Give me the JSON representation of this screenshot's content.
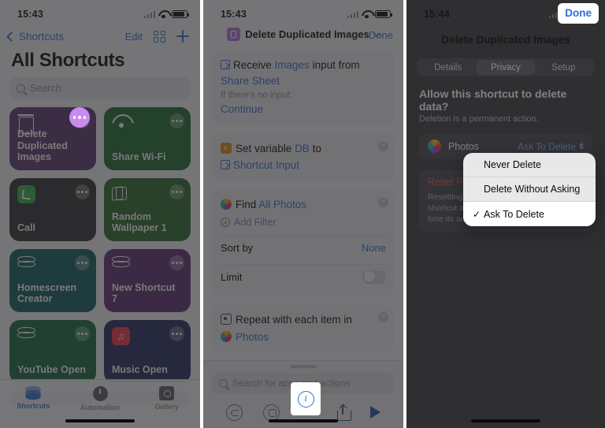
{
  "panel1": {
    "status": {
      "time": "15:43"
    },
    "nav": {
      "back_label": "Shortcuts",
      "edit_label": "Edit"
    },
    "title": "All Shortcuts",
    "search_placeholder": "Search",
    "tiles": [
      {
        "name": "Delete Duplicated Images",
        "icon": "trash-icon",
        "color": "#5a3770",
        "highlighted": true
      },
      {
        "name": "Share Wi-Fi",
        "icon": "wifi-icon",
        "color": "#1e6b2e"
      },
      {
        "name": "Call",
        "icon": "phone-icon",
        "color": "#303034"
      },
      {
        "name": "Random Wallpaper 1",
        "icon": "layers-icon",
        "color": "#2b6b2c"
      },
      {
        "name": "Homescreen Creator",
        "icon": "stack-icon",
        "color": "#0f5c5c"
      },
      {
        "name": "New Shortcut 7",
        "icon": "stack-icon",
        "color": "#5d2e72"
      },
      {
        "name": "YouTube Open",
        "icon": "stack-icon",
        "color": "#16663f"
      },
      {
        "name": "Music Open",
        "icon": "music-icon",
        "color": "#23295c"
      }
    ],
    "tabs": [
      {
        "label": "Shortcuts",
        "icon": "stack-icon",
        "active": true
      },
      {
        "label": "Automation",
        "icon": "clock-icon",
        "active": false
      },
      {
        "label": "Gallery",
        "icon": "gallery-icon",
        "active": false
      }
    ]
  },
  "panel2": {
    "status": {
      "time": "15:43"
    },
    "header": {
      "title": "Delete Duplicated Images",
      "done_label": "Done"
    },
    "cards": {
      "receive": {
        "word_receive": "Receive",
        "token_images": "Images",
        "word_input": "input",
        "word_from": "from",
        "token_sharesheet": "Share Sheet",
        "no_input_label": "If there's no input:",
        "no_input_value": "Continue"
      },
      "setvar": {
        "label": "Set variable",
        "token": "DB",
        "word_to": "to",
        "value": "Shortcut Input"
      },
      "find": {
        "label": "Find",
        "token": "All Photos",
        "add_filter": "Add Filter",
        "sort_label": "Sort by",
        "sort_value": "None",
        "limit_label": "Limit"
      },
      "repeat": {
        "label": "Repeat with each item in",
        "token": "Photos"
      }
    },
    "search_placeholder": "Search for apps and actions",
    "toolbar": [
      {
        "name": "undo-icon",
        "highlighted": false
      },
      {
        "name": "target-icon",
        "highlighted": false
      },
      {
        "name": "info-icon",
        "highlighted": true
      },
      {
        "name": "share-icon",
        "highlighted": false
      },
      {
        "name": "play-icon",
        "highlighted": false
      }
    ]
  },
  "panel3": {
    "status": {
      "time": "15:44"
    },
    "header": {
      "title": "Delete Duplicated Images",
      "done_label": "Done"
    },
    "segments": [
      {
        "label": "Details",
        "selected": false
      },
      {
        "label": "Privacy",
        "selected": true
      },
      {
        "label": "Setup",
        "selected": false
      }
    ],
    "heading": "Allow this shortcut to delete data?",
    "subheading": "Deletion is a permanent action.",
    "permission_row": {
      "app": "Photos",
      "value": "Ask To Delete"
    },
    "reset": {
      "title": "Reset Privacy Settings",
      "description": "Resetting privacy settings will make this shortcut ask for permission again the next time its actions run."
    },
    "menu": [
      {
        "label": "Never Delete",
        "selected": false
      },
      {
        "label": "Delete Without Asking",
        "selected": false
      },
      {
        "label": "Ask To Delete",
        "selected": true,
        "check": "✓"
      }
    ]
  }
}
